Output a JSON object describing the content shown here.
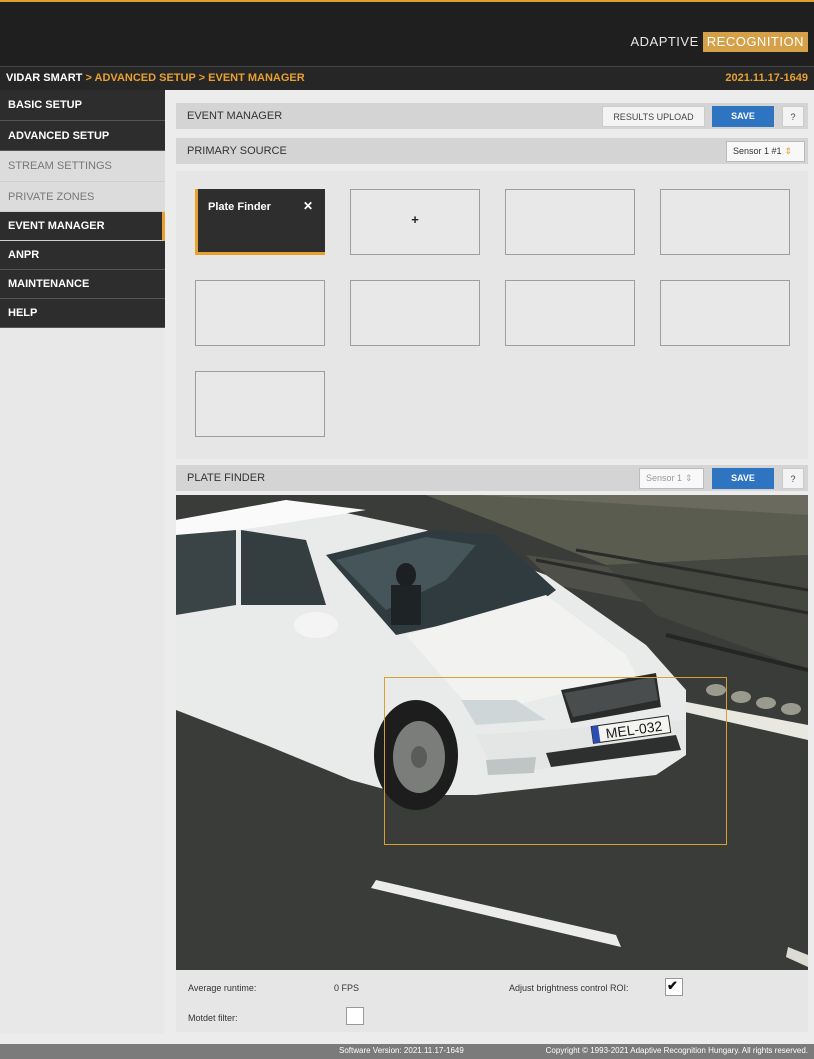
{
  "brand": {
    "part1": "ADAPTIVE",
    "part2": "RECOGNITION"
  },
  "breadcrumb": {
    "root": "VIDAR SMART",
    "sep": " > ",
    "level1": "ADVANCED SETUP",
    "level2": "EVENT MANAGER"
  },
  "version": "2021.11.17-1649",
  "sidebar": {
    "items": [
      {
        "label": "BASIC SETUP"
      },
      {
        "label": "ADVANCED SETUP"
      },
      {
        "label": "STREAM SETTINGS"
      },
      {
        "label": "PRIVATE ZONES"
      },
      {
        "label": "EVENT MANAGER"
      },
      {
        "label": "ANPR"
      },
      {
        "label": "MAINTENANCE"
      },
      {
        "label": "HELP"
      }
    ]
  },
  "event_manager": {
    "title": "EVENT MANAGER",
    "results_upload": "RESULTS UPLOAD",
    "save": "SAVE",
    "help": "?"
  },
  "primary_source": {
    "title": "PRIMARY SOURCE",
    "selected": "Sensor 1 #1"
  },
  "slots": {
    "filled_name": "Plate Finder",
    "close": "✕",
    "add": "+"
  },
  "plate_finder": {
    "title": "PLATE FINDER",
    "sensor": "Sensor 1",
    "save": "SAVE",
    "help": "?"
  },
  "camera": {
    "plate_text": "MEL-032"
  },
  "controls": {
    "avg_runtime_label": "Average runtime:",
    "avg_runtime_value": "0 FPS",
    "brightness_label": "Adjust brightness control ROI:",
    "brightness_checked": true,
    "motdet_label": "Motdet filter:",
    "motdet_checked": false
  },
  "footer": {
    "software_version": "Software Version:   2021.11.17-1649",
    "copyright": "Copyright © 1993-2021 Adaptive Recognition Hungary. All rights reserved."
  },
  "colors": {
    "accent": "#e8a030",
    "save_blue": "#2e74c0",
    "dark": "#2d2d2d"
  }
}
